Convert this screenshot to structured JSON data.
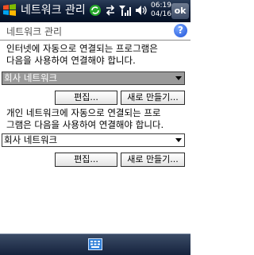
{
  "titlebar": {
    "title": "네트워크 관리",
    "time": "06:19",
    "date": "04/16",
    "ok_label": "ok",
    "icons": [
      "windows-start-icon",
      "sync-icon",
      "data-connection-icon",
      "signal-icon",
      "volume-icon"
    ]
  },
  "header": {
    "title": "네트워크 관리",
    "help_label": "?"
  },
  "internet": {
    "description_line1": "인터넷에 자동으로 연결되는 프로그램은",
    "description_line2": "다음을 사용하여 연결해야 합니다.",
    "selected": "회사 네트워크",
    "edit_label": "편집...",
    "new_label": "새로 만들기..."
  },
  "private": {
    "description_line1": "개인 네트워크에 자동으로 연결되는 프로",
    "description_line2": "그램은 다음을 사용하여 연결해야 합니다.",
    "selected": "회사 네트워크",
    "edit_label": "편집...",
    "new_label": "새로 만들기..."
  },
  "taskbar": {
    "input_icon": "keyboard-icon"
  },
  "colors": {
    "titlebar": "#0c1a33",
    "selected_dropdown": "#9a9a9a",
    "help_blue": "#1e52d8"
  }
}
